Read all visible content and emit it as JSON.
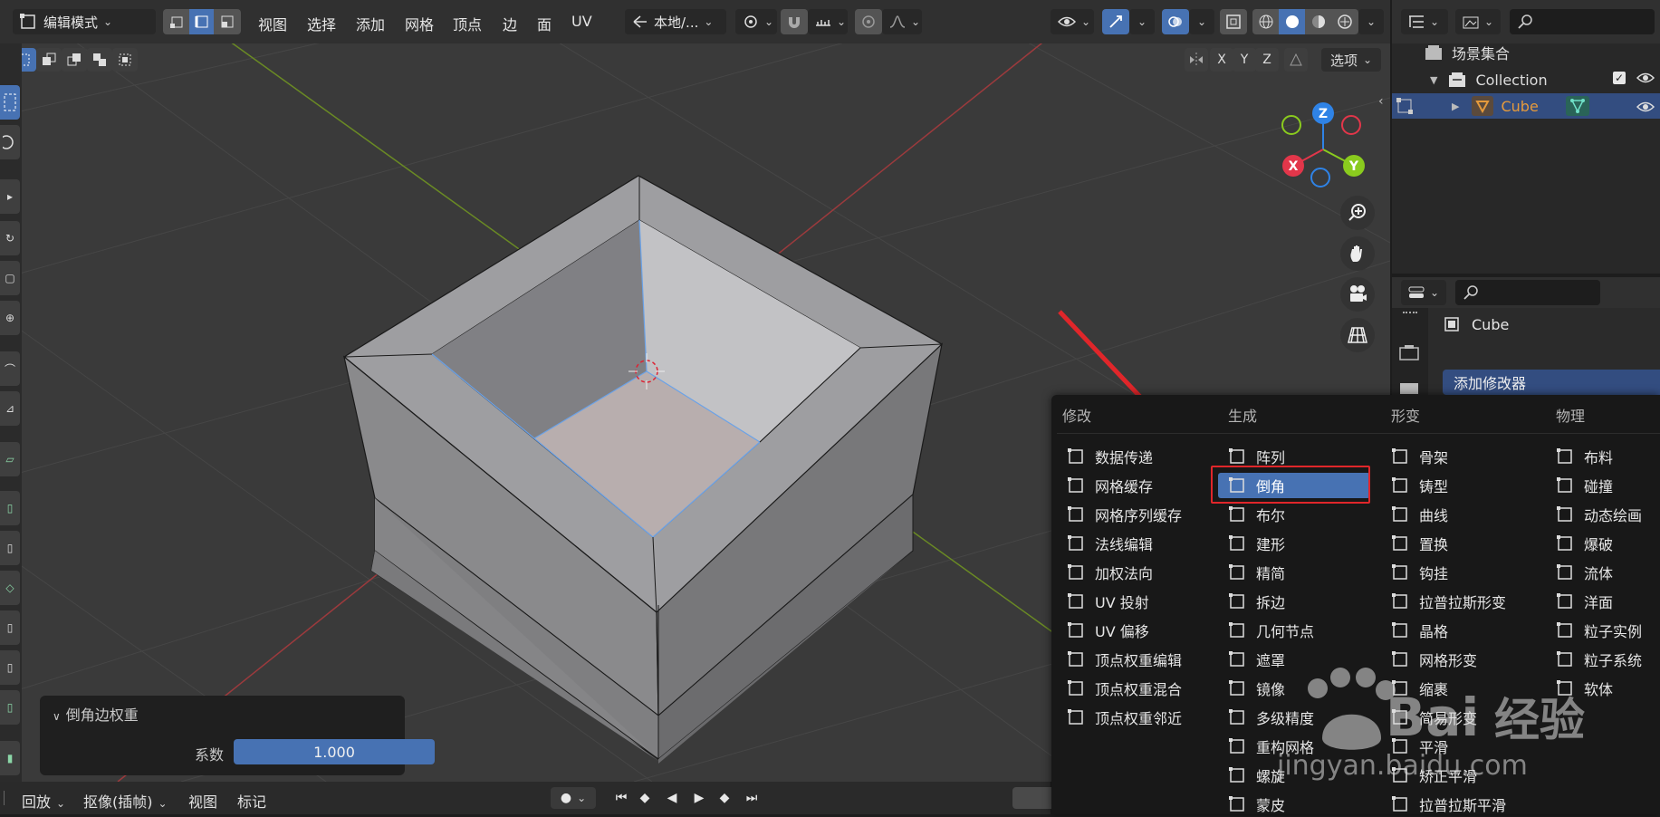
{
  "header": {
    "mode": "编辑模式",
    "menus": [
      "视图",
      "选择",
      "添加",
      "网格",
      "顶点",
      "边",
      "面",
      "UV"
    ],
    "transform_orientation": "本地/...",
    "axes": [
      "X",
      "Y",
      "Z"
    ],
    "options_label": "选项"
  },
  "gizmo": {
    "z": "Z",
    "y": "Y",
    "x": "X"
  },
  "op_panel": {
    "title": "倒角边权重",
    "factor_label": "系数",
    "factor_value": "1.000"
  },
  "timeline": {
    "menus": [
      "回放",
      "抠像(插帧)",
      "视图",
      "标记"
    ]
  },
  "outliner": {
    "scene_collection": "场景集合",
    "collection": "Collection",
    "object": "Cube"
  },
  "properties": {
    "object_name": "Cube",
    "add_modifier": "添加修改器"
  },
  "modifier_menu": {
    "columns": [
      {
        "header": "修改",
        "items": [
          {
            "label": "数据传递",
            "icon": "data-transfer-icon"
          },
          {
            "label": "网格缓存",
            "icon": "mesh-cache-icon"
          },
          {
            "label": "网格序列缓存",
            "icon": "mesh-sequence-cache-icon"
          },
          {
            "label": "法线编辑",
            "icon": "normal-edit-icon"
          },
          {
            "label": "加权法向",
            "icon": "weighted-normal-icon"
          },
          {
            "label": "UV 投射",
            "icon": "uv-project-icon"
          },
          {
            "label": "UV 偏移",
            "icon": "uv-warp-icon"
          },
          {
            "label": "顶点权重编辑",
            "icon": "vertex-weight-edit-icon"
          },
          {
            "label": "顶点权重混合",
            "icon": "vertex-weight-mix-icon"
          },
          {
            "label": "顶点权重邻近",
            "icon": "vertex-weight-proximity-icon"
          }
        ]
      },
      {
        "header": "生成",
        "items": [
          {
            "label": "阵列",
            "icon": "array-icon"
          },
          {
            "label": "倒角",
            "icon": "bevel-icon"
          },
          {
            "label": "布尔",
            "icon": "boolean-icon"
          },
          {
            "label": "建形",
            "icon": "build-icon"
          },
          {
            "label": "精简",
            "icon": "decimate-icon"
          },
          {
            "label": "拆边",
            "icon": "edge-split-icon"
          },
          {
            "label": "几何节点",
            "icon": "geometry-nodes-icon"
          },
          {
            "label": "遮罩",
            "icon": "mask-icon"
          },
          {
            "label": "镜像",
            "icon": "mirror-icon"
          },
          {
            "label": "多级精度",
            "icon": "multires-icon"
          },
          {
            "label": "重构网格",
            "icon": "remesh-icon"
          },
          {
            "label": "螺旋",
            "icon": "screw-icon"
          },
          {
            "label": "蒙皮",
            "icon": "skin-icon"
          }
        ]
      },
      {
        "header": "形变",
        "items": [
          {
            "label": "骨架",
            "icon": "armature-icon"
          },
          {
            "label": "铸型",
            "icon": "cast-icon"
          },
          {
            "label": "曲线",
            "icon": "curve-icon"
          },
          {
            "label": "置换",
            "icon": "displace-icon"
          },
          {
            "label": "钩挂",
            "icon": "hook-icon"
          },
          {
            "label": "拉普拉斯形变",
            "icon": "laplacian-deform-icon"
          },
          {
            "label": "晶格",
            "icon": "lattice-icon"
          },
          {
            "label": "网格形变",
            "icon": "mesh-deform-icon"
          },
          {
            "label": "缩裹",
            "icon": "shrinkwrap-icon"
          },
          {
            "label": "简易形变",
            "icon": "simple-deform-icon"
          },
          {
            "label": "平滑",
            "icon": "smooth-icon"
          },
          {
            "label": "矫正平滑",
            "icon": "corrective-smooth-icon"
          },
          {
            "label": "拉普拉斯平滑",
            "icon": "laplacian-smooth-icon"
          }
        ]
      },
      {
        "header": "物理",
        "items": [
          {
            "label": "布料",
            "icon": "cloth-icon"
          },
          {
            "label": "碰撞",
            "icon": "collision-icon"
          },
          {
            "label": "动态绘画",
            "icon": "dynamic-paint-icon"
          },
          {
            "label": "爆破",
            "icon": "explode-icon"
          },
          {
            "label": "流体",
            "icon": "fluid-icon"
          },
          {
            "label": "洋面",
            "icon": "ocean-icon"
          },
          {
            "label": "粒子实例",
            "icon": "particle-instance-icon"
          },
          {
            "label": "粒子系统",
            "icon": "particle-system-icon"
          },
          {
            "label": "软体",
            "icon": "soft-body-icon"
          }
        ]
      }
    ],
    "highlighted": "倒角"
  },
  "watermark": {
    "brand": "Bai",
    "brand2": "经验",
    "url": "jingyan.baidu.com"
  },
  "colors": {
    "accent": "#4772b3",
    "annotation": "#e0262a",
    "axis_x": "#e2364a",
    "axis_y": "#8acb1e",
    "axis_z": "#2f83e6",
    "object_orange": "#e59a3c"
  }
}
